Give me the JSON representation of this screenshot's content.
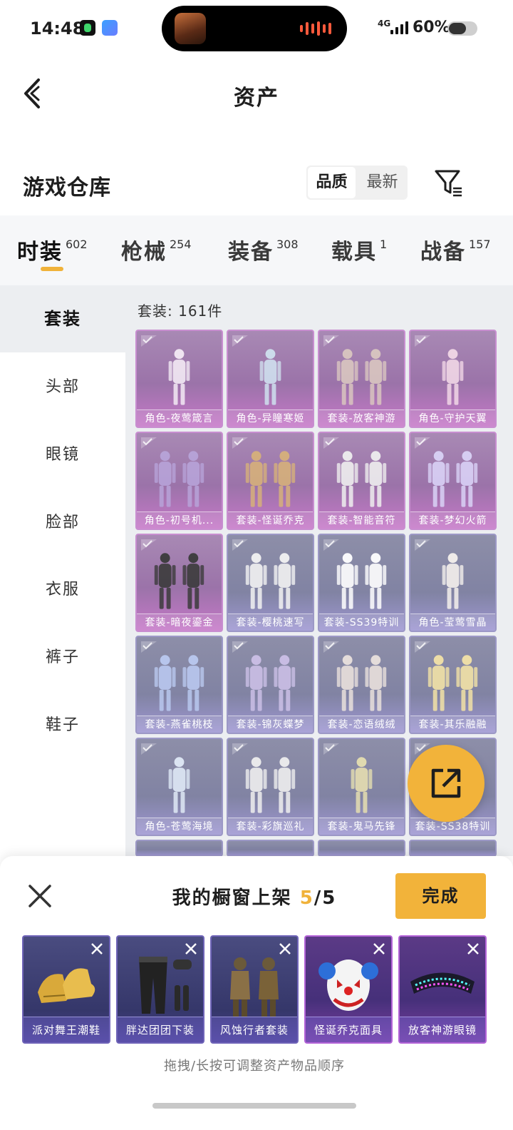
{
  "status_bar": {
    "time": "14:48",
    "network": "4G",
    "battery": "60%"
  },
  "header": {
    "title": "资产",
    "back_icon": "chevron-left-icon"
  },
  "warehouse": {
    "title": "游戏仓库",
    "sort_options": [
      "品质",
      "最新"
    ],
    "active_sort": "品质",
    "filter_icon": "filter-icon"
  },
  "tabs": [
    {
      "label": "时装",
      "count": "602"
    },
    {
      "label": "枪械",
      "count": "254"
    },
    {
      "label": "装备",
      "count": "308"
    },
    {
      "label": "载具",
      "count": "1"
    },
    {
      "label": "战备",
      "count": "157"
    }
  ],
  "active_tab": "时装",
  "subcategories": [
    "套装",
    "头部",
    "眼镜",
    "脸部",
    "衣服",
    "裤子",
    "鞋子"
  ],
  "active_subcategory": "套装",
  "grid": {
    "count_label": "套装: 161件",
    "items": [
      {
        "label": "角色-夜莺箴言",
        "rarity": "pink"
      },
      {
        "label": "角色-异瞳寒姬",
        "rarity": "pink"
      },
      {
        "label": "套装-放客神游",
        "rarity": "pink"
      },
      {
        "label": "角色-守护天翼",
        "rarity": "pink"
      },
      {
        "label": "角色-初号机...",
        "rarity": "pink"
      },
      {
        "label": "套装-怪诞乔克",
        "rarity": "pink"
      },
      {
        "label": "套装-智能音符",
        "rarity": "pink"
      },
      {
        "label": "套装-梦幻火箭",
        "rarity": "pink"
      },
      {
        "label": "套装-暗夜鎏金",
        "rarity": "pink"
      },
      {
        "label": "套装-樱桃速写",
        "rarity": "blue"
      },
      {
        "label": "套装-SS39特训",
        "rarity": "blue"
      },
      {
        "label": "角色-莹莺雪晶",
        "rarity": "blue"
      },
      {
        "label": "套装-燕雀桃枝",
        "rarity": "blue"
      },
      {
        "label": "套装-锦灰蝶梦",
        "rarity": "blue"
      },
      {
        "label": "套装-恋语绒绒",
        "rarity": "blue"
      },
      {
        "label": "套装-其乐融融",
        "rarity": "blue"
      },
      {
        "label": "角色-苍莺海境",
        "rarity": "blue"
      },
      {
        "label": "套装-彩旗巡礼",
        "rarity": "blue"
      },
      {
        "label": "套装-鬼马先锋",
        "rarity": "blue"
      },
      {
        "label": "套装-SS38特训",
        "rarity": "blue"
      }
    ]
  },
  "fab_icon": "share-icon",
  "showcase": {
    "title_prefix": "我的橱窗上架 ",
    "current": "5",
    "total": "/5",
    "done_label": "完成",
    "close_icon": "close-icon",
    "items": [
      {
        "label": "派对舞王潮鞋",
        "style": "navy",
        "art": "gold-sneakers"
      },
      {
        "label": "胖达团团下装",
        "style": "navy",
        "art": "black-pants"
      },
      {
        "label": "风蚀行者套装",
        "style": "navy",
        "art": "desert-outfit"
      },
      {
        "label": "怪诞乔克面具",
        "style": "purple",
        "art": "clown-mask"
      },
      {
        "label": "放客神游眼镜",
        "style": "purple",
        "art": "led-glasses"
      }
    ],
    "hint": "拖拽/长按可调整资产物品顺序"
  }
}
